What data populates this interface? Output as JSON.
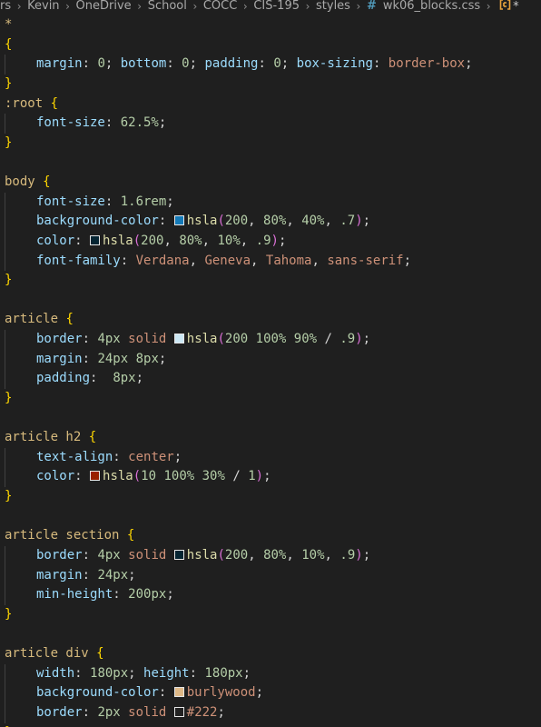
{
  "breadcrumb": {
    "items": [
      "rs",
      "Kevin",
      "OneDrive",
      "School",
      "COCC",
      "CIS-195",
      "styles"
    ],
    "file_icon": "#",
    "file_name": "wk06_blocks.css",
    "symbol_icon": "css-selector-icon",
    "modified_marker": "*"
  },
  "code_lines": [
    [
      {
        "t": "*",
        "c": "sel"
      }
    ],
    [
      {
        "t": "{",
        "c": "brace"
      }
    ],
    [
      {
        "i": 1
      },
      {
        "t": "margin",
        "c": "prop"
      },
      {
        "t": ": ",
        "c": "punc"
      },
      {
        "t": "0",
        "c": "num"
      },
      {
        "t": "; ",
        "c": "punc"
      },
      {
        "t": "bottom",
        "c": "prop"
      },
      {
        "t": ": ",
        "c": "punc"
      },
      {
        "t": "0",
        "c": "num"
      },
      {
        "t": "; ",
        "c": "punc"
      },
      {
        "t": "padding",
        "c": "prop"
      },
      {
        "t": ": ",
        "c": "punc"
      },
      {
        "t": "0",
        "c": "num"
      },
      {
        "t": "; ",
        "c": "punc"
      },
      {
        "t": "box-sizing",
        "c": "prop"
      },
      {
        "t": ": ",
        "c": "punc"
      },
      {
        "t": "border-box",
        "c": "kw"
      },
      {
        "t": ";",
        "c": "punc"
      }
    ],
    [
      {
        "t": "}",
        "c": "brace"
      }
    ],
    [
      {
        "t": ":root ",
        "c": "sel"
      },
      {
        "t": "{",
        "c": "brace"
      }
    ],
    [
      {
        "i": 1
      },
      {
        "t": "font-size",
        "c": "prop"
      },
      {
        "t": ": ",
        "c": "punc"
      },
      {
        "t": "62.5%",
        "c": "num"
      },
      {
        "t": ";",
        "c": "punc"
      }
    ],
    [
      {
        "t": "}",
        "c": "brace"
      }
    ],
    [],
    [
      {
        "t": "body ",
        "c": "sel"
      },
      {
        "t": "{",
        "c": "brace"
      }
    ],
    [
      {
        "i": 1
      },
      {
        "t": "font-size",
        "c": "prop"
      },
      {
        "t": ": ",
        "c": "punc"
      },
      {
        "t": "1.6rem",
        "c": "num"
      },
      {
        "t": ";",
        "c": "punc"
      }
    ],
    [
      {
        "i": 1
      },
      {
        "t": "background-color",
        "c": "prop"
      },
      {
        "t": ": ",
        "c": "punc"
      },
      {
        "sw": "#147ab8"
      },
      {
        "t": "hsla",
        "c": "fn"
      },
      {
        "t": "(",
        "c": "paren"
      },
      {
        "t": "200",
        "c": "num"
      },
      {
        "t": ", ",
        "c": "punc"
      },
      {
        "t": "80%",
        "c": "num"
      },
      {
        "t": ", ",
        "c": "punc"
      },
      {
        "t": "40%",
        "c": "num"
      },
      {
        "t": ", ",
        "c": "punc"
      },
      {
        "t": ".7",
        "c": "num"
      },
      {
        "t": ")",
        "c": "paren"
      },
      {
        "t": ";",
        "c": "punc"
      }
    ],
    [
      {
        "i": 1
      },
      {
        "t": "color",
        "c": "prop"
      },
      {
        "t": ": ",
        "c": "punc"
      },
      {
        "sw": "#052533"
      },
      {
        "t": "hsla",
        "c": "fn"
      },
      {
        "t": "(",
        "c": "paren"
      },
      {
        "t": "200",
        "c": "num"
      },
      {
        "t": ", ",
        "c": "punc"
      },
      {
        "t": "80%",
        "c": "num"
      },
      {
        "t": ", ",
        "c": "punc"
      },
      {
        "t": "10%",
        "c": "num"
      },
      {
        "t": ", ",
        "c": "punc"
      },
      {
        "t": ".9",
        "c": "num"
      },
      {
        "t": ")",
        "c": "paren"
      },
      {
        "t": ";",
        "c": "punc"
      }
    ],
    [
      {
        "i": 1
      },
      {
        "t": "font-family",
        "c": "prop"
      },
      {
        "t": ": ",
        "c": "punc"
      },
      {
        "t": "Verdana",
        "c": "kw"
      },
      {
        "t": ", ",
        "c": "punc"
      },
      {
        "t": "Geneva",
        "c": "kw"
      },
      {
        "t": ", ",
        "c": "punc"
      },
      {
        "t": "Tahoma",
        "c": "kw"
      },
      {
        "t": ", ",
        "c": "punc"
      },
      {
        "t": "sans-serif",
        "c": "kw"
      },
      {
        "t": ";",
        "c": "punc"
      }
    ],
    [
      {
        "t": "}",
        "c": "brace"
      }
    ],
    [],
    [
      {
        "t": "article ",
        "c": "sel"
      },
      {
        "t": "{",
        "c": "brace"
      }
    ],
    [
      {
        "i": 1
      },
      {
        "t": "border",
        "c": "prop"
      },
      {
        "t": ": ",
        "c": "punc"
      },
      {
        "t": "4px",
        "c": "num"
      },
      {
        "t": " ",
        "c": "punc"
      },
      {
        "t": "solid",
        "c": "kw"
      },
      {
        "t": " ",
        "c": "punc"
      },
      {
        "sw": "#cce8f5"
      },
      {
        "t": "hsla",
        "c": "fn"
      },
      {
        "t": "(",
        "c": "paren"
      },
      {
        "t": "200 100% 90%",
        "c": "num"
      },
      {
        "t": " / ",
        "c": "punc"
      },
      {
        "t": ".9",
        "c": "num"
      },
      {
        "t": ")",
        "c": "paren"
      },
      {
        "t": ";",
        "c": "punc"
      }
    ],
    [
      {
        "i": 1
      },
      {
        "t": "margin",
        "c": "prop"
      },
      {
        "t": ": ",
        "c": "punc"
      },
      {
        "t": "24px 8px",
        "c": "num"
      },
      {
        "t": ";",
        "c": "punc"
      }
    ],
    [
      {
        "i": 1
      },
      {
        "t": "padding",
        "c": "prop"
      },
      {
        "t": ":  ",
        "c": "punc"
      },
      {
        "t": "8px",
        "c": "num"
      },
      {
        "t": ";",
        "c": "punc"
      }
    ],
    [
      {
        "t": "}",
        "c": "brace"
      }
    ],
    [],
    [
      {
        "t": "article h2 ",
        "c": "sel"
      },
      {
        "t": "{",
        "c": "brace"
      }
    ],
    [
      {
        "i": 1
      },
      {
        "t": "text-align",
        "c": "prop"
      },
      {
        "t": ": ",
        "c": "punc"
      },
      {
        "t": "center",
        "c": "kw"
      },
      {
        "t": ";",
        "c": "punc"
      }
    ],
    [
      {
        "i": 1
      },
      {
        "t": "color",
        "c": "prop"
      },
      {
        "t": ": ",
        "c": "punc"
      },
      {
        "sw": "#991f00"
      },
      {
        "t": "hsla",
        "c": "fn"
      },
      {
        "t": "(",
        "c": "paren"
      },
      {
        "t": "10 100% 30%",
        "c": "num"
      },
      {
        "t": " / ",
        "c": "punc"
      },
      {
        "t": "1",
        "c": "num"
      },
      {
        "t": ")",
        "c": "paren"
      },
      {
        "t": ";",
        "c": "punc"
      }
    ],
    [
      {
        "t": "}",
        "c": "brace"
      }
    ],
    [],
    [
      {
        "t": "article section ",
        "c": "sel"
      },
      {
        "t": "{",
        "c": "brace"
      }
    ],
    [
      {
        "i": 1
      },
      {
        "t": "border",
        "c": "prop"
      },
      {
        "t": ": ",
        "c": "punc"
      },
      {
        "t": "4px",
        "c": "num"
      },
      {
        "t": " ",
        "c": "punc"
      },
      {
        "t": "solid",
        "c": "kw"
      },
      {
        "t": " ",
        "c": "punc"
      },
      {
        "sw": "#052533"
      },
      {
        "t": "hsla",
        "c": "fn"
      },
      {
        "t": "(",
        "c": "paren"
      },
      {
        "t": "200",
        "c": "num"
      },
      {
        "t": ", ",
        "c": "punc"
      },
      {
        "t": "80%",
        "c": "num"
      },
      {
        "t": ", ",
        "c": "punc"
      },
      {
        "t": "10%",
        "c": "num"
      },
      {
        "t": ", ",
        "c": "punc"
      },
      {
        "t": ".9",
        "c": "num"
      },
      {
        "t": ")",
        "c": "paren"
      },
      {
        "t": ";",
        "c": "punc"
      }
    ],
    [
      {
        "i": 1
      },
      {
        "t": "margin",
        "c": "prop"
      },
      {
        "t": ": ",
        "c": "punc"
      },
      {
        "t": "24px",
        "c": "num"
      },
      {
        "t": ";",
        "c": "punc"
      }
    ],
    [
      {
        "i": 1
      },
      {
        "t": "min-height",
        "c": "prop"
      },
      {
        "t": ": ",
        "c": "punc"
      },
      {
        "t": "200px",
        "c": "num"
      },
      {
        "t": ";",
        "c": "punc"
      }
    ],
    [
      {
        "t": "}",
        "c": "brace"
      }
    ],
    [],
    [
      {
        "t": "article div ",
        "c": "sel"
      },
      {
        "t": "{",
        "c": "brace"
      }
    ],
    [
      {
        "i": 1
      },
      {
        "t": "width",
        "c": "prop"
      },
      {
        "t": ": ",
        "c": "punc"
      },
      {
        "t": "180px",
        "c": "num"
      },
      {
        "t": "; ",
        "c": "punc"
      },
      {
        "t": "height",
        "c": "prop"
      },
      {
        "t": ": ",
        "c": "punc"
      },
      {
        "t": "180px",
        "c": "num"
      },
      {
        "t": ";",
        "c": "punc"
      }
    ],
    [
      {
        "i": 1
      },
      {
        "t": "background-color",
        "c": "prop"
      },
      {
        "t": ": ",
        "c": "punc"
      },
      {
        "sw": "#deb887"
      },
      {
        "t": "burlywood",
        "c": "kw"
      },
      {
        "t": ";",
        "c": "punc"
      }
    ],
    [
      {
        "i": 1
      },
      {
        "t": "border",
        "c": "prop"
      },
      {
        "t": ": ",
        "c": "punc"
      },
      {
        "t": "2px",
        "c": "num"
      },
      {
        "t": " ",
        "c": "punc"
      },
      {
        "t": "solid",
        "c": "kw"
      },
      {
        "t": " ",
        "c": "punc"
      },
      {
        "sw": "#222222"
      },
      {
        "t": "#222",
        "c": "kw"
      },
      {
        "t": ";",
        "c": "punc"
      }
    ],
    [
      {
        "t": "}",
        "c": "brace"
      }
    ]
  ]
}
